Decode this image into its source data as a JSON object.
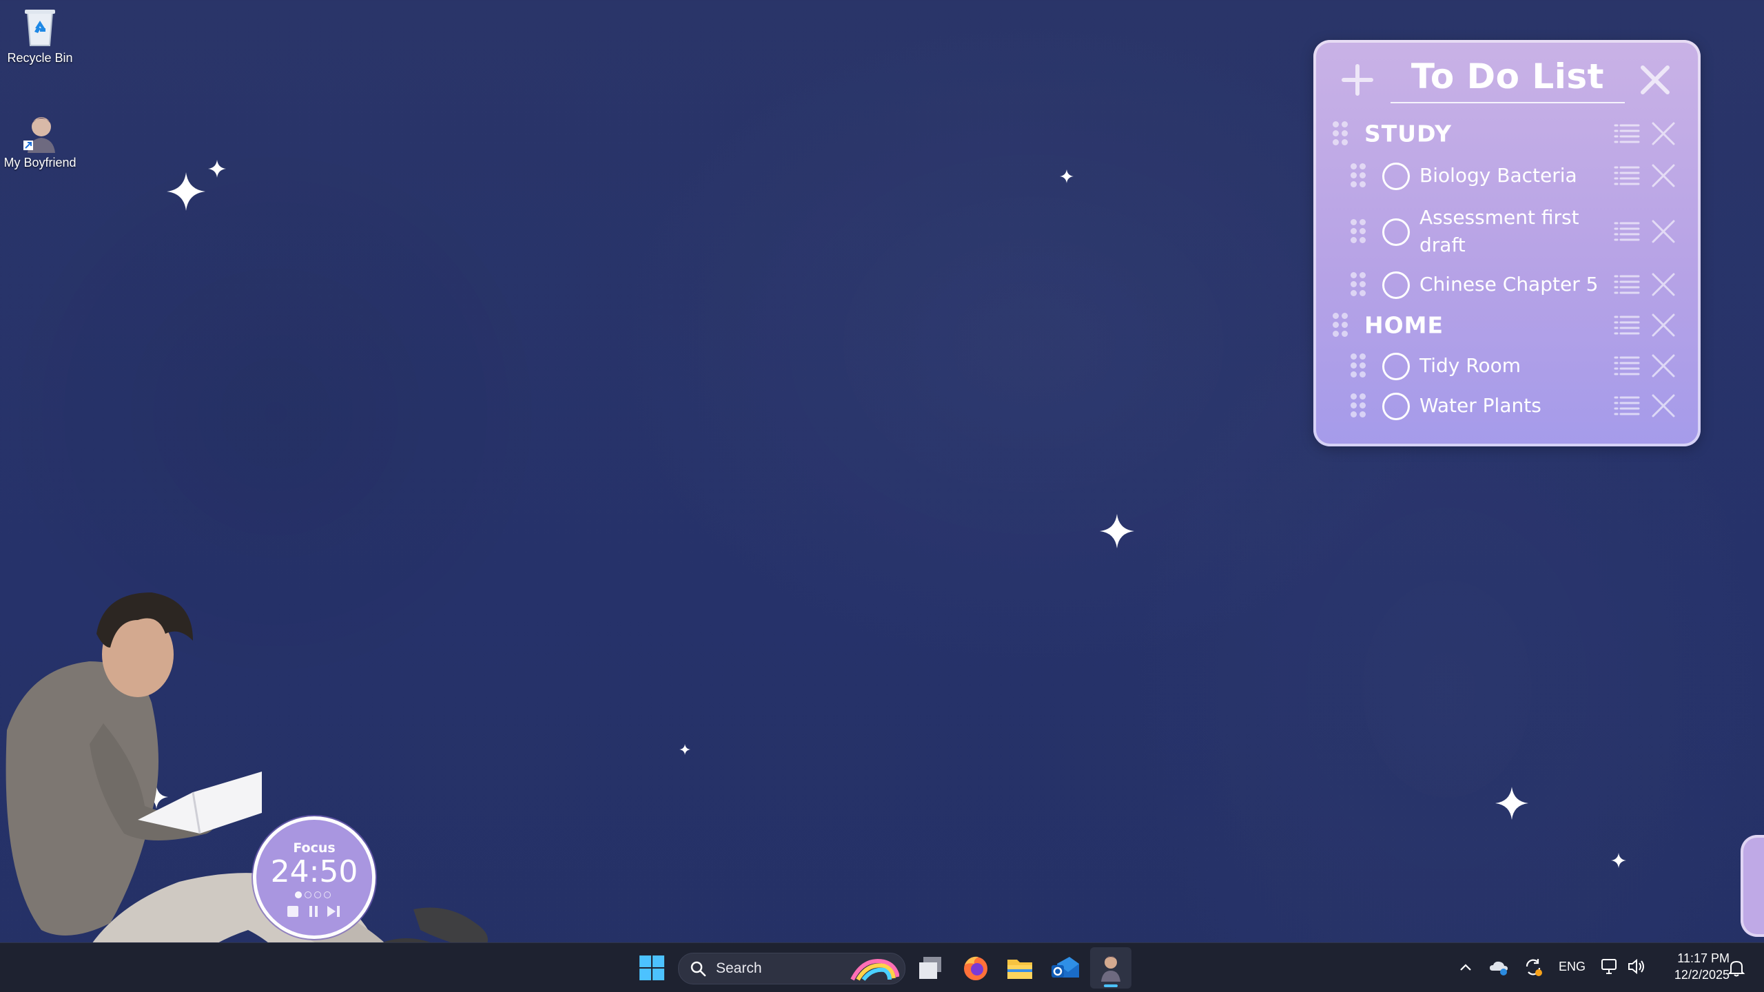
{
  "desktop": {
    "icons": [
      {
        "label": "Recycle Bin",
        "icon": "recycle-bin-icon"
      },
      {
        "label": "My Boyfriend",
        "icon": "character-shortcut-icon"
      }
    ]
  },
  "todo": {
    "title": "To Do List",
    "add_icon": "plus-icon",
    "close_icon": "close-icon",
    "categories": [
      {
        "label": "STUDY",
        "items": [
          {
            "label": "Biology Bacteria",
            "checked": false
          },
          {
            "label": "Assessment first draft",
            "checked": false
          },
          {
            "label": "Chinese Chapter 5",
            "checked": false
          }
        ]
      },
      {
        "label": "HOME",
        "items": [
          {
            "label": "Tidy Room",
            "checked": false
          },
          {
            "label": "Water Plants",
            "checked": false
          }
        ]
      }
    ]
  },
  "focus_timer": {
    "label": "Focus",
    "time": "24:50",
    "controls": [
      "stop-icon",
      "pause-icon",
      "skip-icon"
    ]
  },
  "taskbar": {
    "search_label": "Search",
    "apps": [
      "start-icon",
      "search-icon",
      "task-view-icon",
      "firefox-icon",
      "file-explorer-icon",
      "outlook-icon",
      "character-app-icon"
    ],
    "tray": {
      "language": "ENG",
      "time": "11:17 PM",
      "date": "12/2/2025"
    }
  },
  "colors": {
    "desktop_bg": "#2a3569",
    "todo_bg_top": "#c9b2e6",
    "todo_bg_bottom": "#a59bea",
    "taskbar_bg": "#1e2230"
  }
}
